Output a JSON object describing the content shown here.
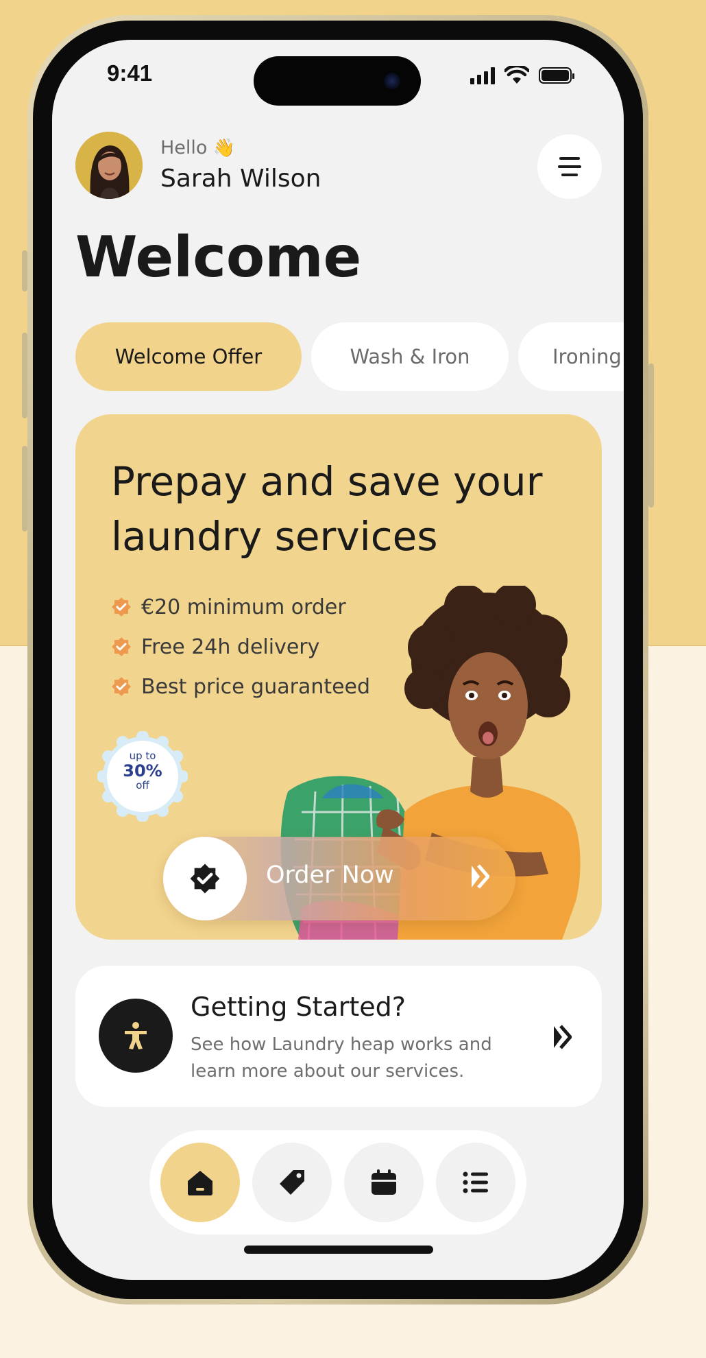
{
  "status_bar": {
    "time": "9:41"
  },
  "header": {
    "greeting": "Hello",
    "wave_emoji": "👋",
    "user_name": "Sarah Wilson",
    "avatar_icon": "user-avatar",
    "menu_icon": "menu-icon"
  },
  "page_title": "Welcome",
  "categories": [
    {
      "label": "Welcome Offer",
      "active": true
    },
    {
      "label": "Wash & Iron",
      "active": false
    },
    {
      "label": "Ironing",
      "active": false
    }
  ],
  "promo": {
    "title": "Prepay and save your laundry services",
    "features": [
      "€20 minimum order",
      "Free 24h delivery",
      "Best price guaranteed"
    ],
    "badge": {
      "top": "up to",
      "value": "30%",
      "bottom": "off"
    },
    "order_button": {
      "label": "Order Now",
      "icon": "verified-badge-icon",
      "arrow_icon": "double-chevron-right-icon"
    }
  },
  "getting_started": {
    "title": "Getting Started?",
    "description": "See how Laundry heap works and learn more about our services.",
    "icon": "accessibility-person-icon",
    "arrow_icon": "double-chevron-right-icon"
  },
  "tab_bar": [
    {
      "icon": "home-icon",
      "active": true
    },
    {
      "icon": "tag-icon",
      "active": false
    },
    {
      "icon": "calendar-icon",
      "active": false
    },
    {
      "icon": "list-icon",
      "active": false
    }
  ],
  "colors": {
    "accent": "#F2D38C",
    "background_top": "#F2D38C",
    "background_bottom": "#FBF2E1",
    "screen": "#F2F2F2",
    "check_orange": "#EE9A4E",
    "dark": "#1A1A1A"
  }
}
